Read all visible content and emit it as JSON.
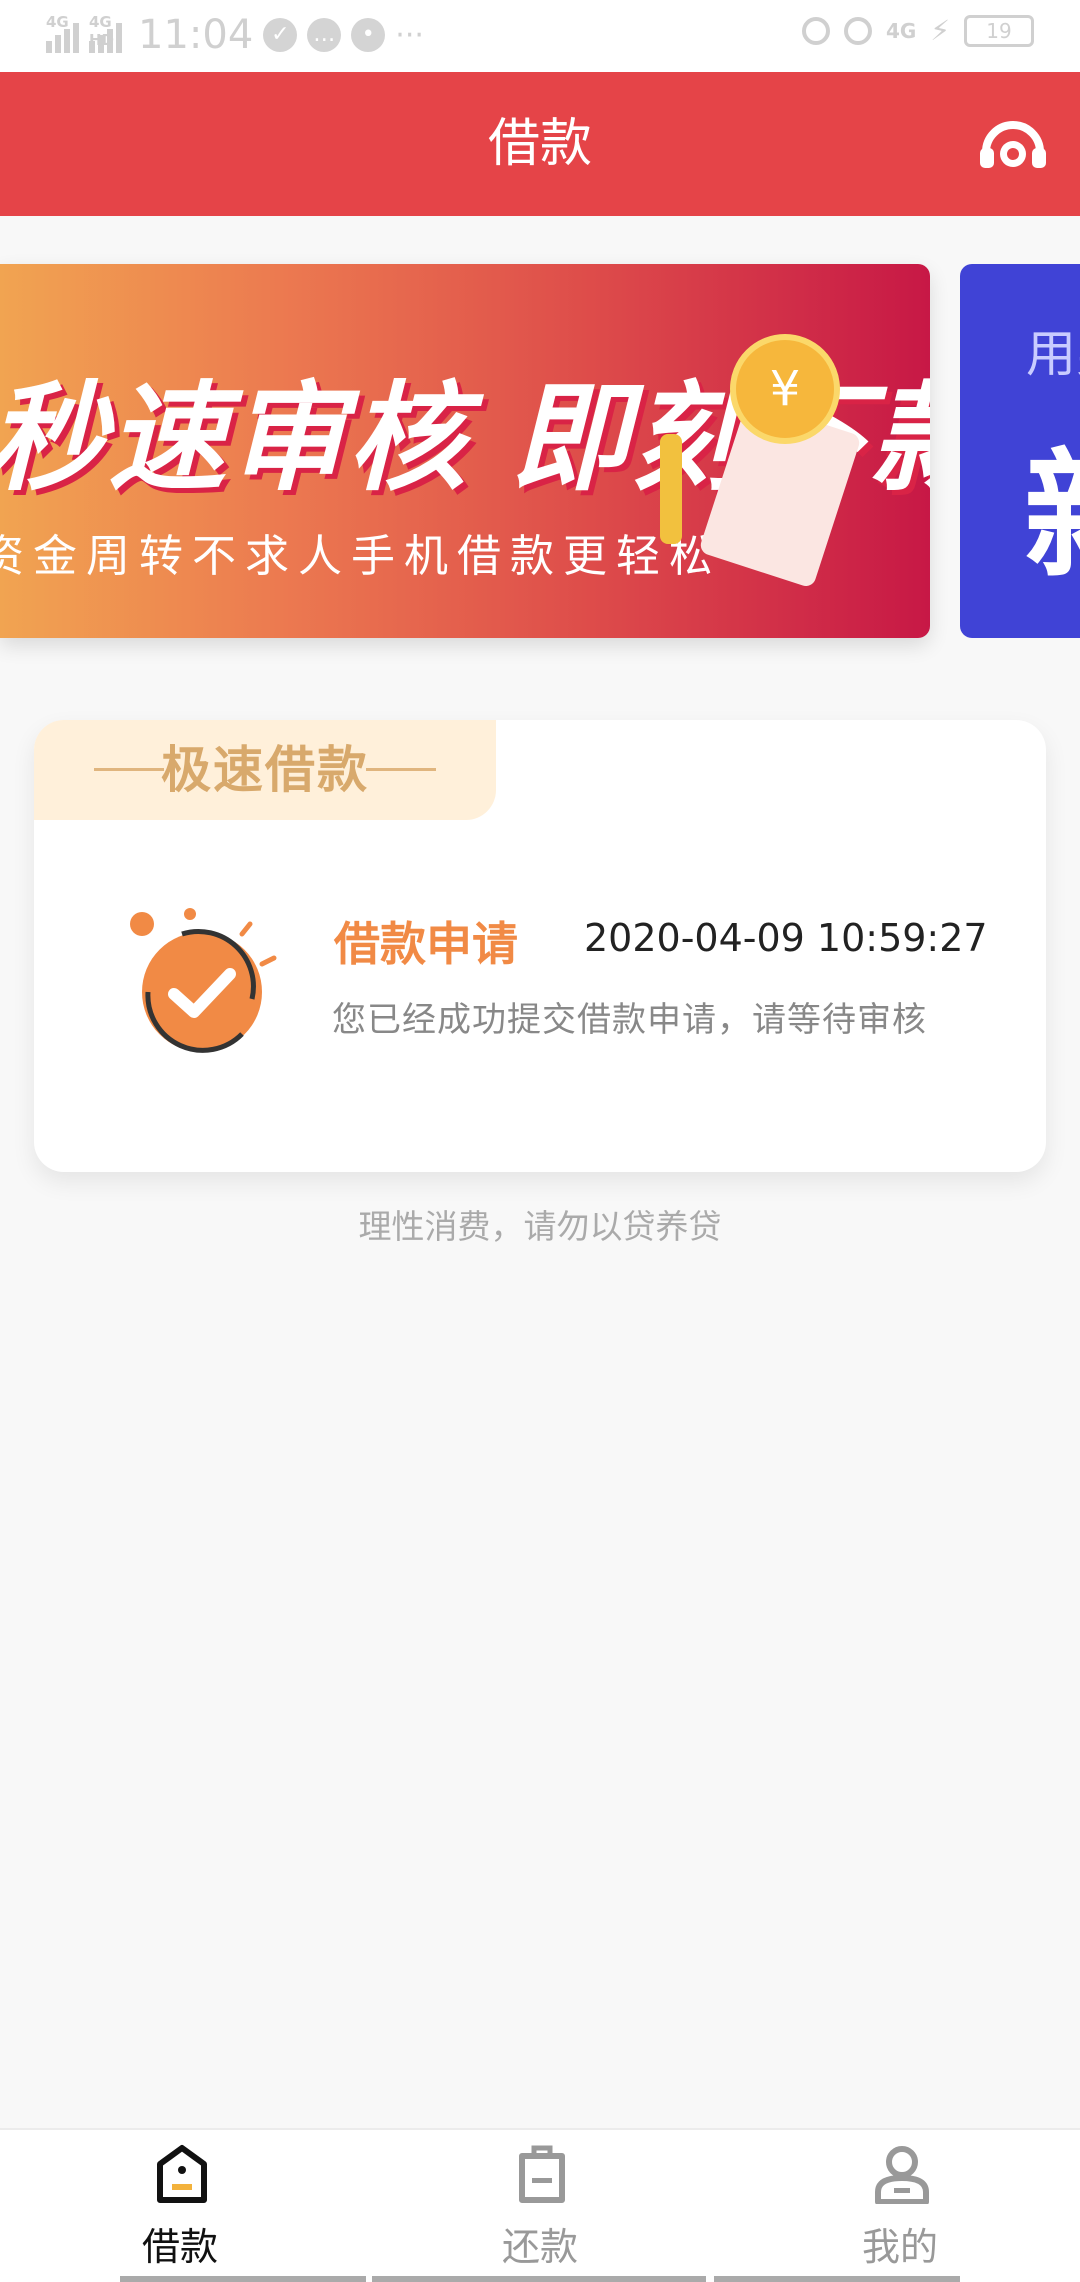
{
  "status_bar": {
    "time": "11:04",
    "network_1": "4G",
    "network_2": "4G HD",
    "network_right": "4G",
    "battery": "19"
  },
  "header": {
    "title": "借款",
    "icon": "headset-icon"
  },
  "banners": [
    {
      "headline": "秒速审核 即刻下款",
      "subline": "资金周转不求人手机借款更轻松"
    },
    {
      "headline_partial": "新",
      "subline_partial": "用身"
    }
  ],
  "loan_card": {
    "tab_label": "极速借款",
    "status_title": "借款申请",
    "status_time": "2020-04-09 10:59:27",
    "status_desc": "您已经成功提交借款申请，请等待审核"
  },
  "tip": "理性消费，请勿以贷养贷",
  "tabbar": {
    "items": [
      {
        "label": "借款",
        "icon": "borrow-icon",
        "active": true
      },
      {
        "label": "还款",
        "icon": "repay-icon",
        "active": false
      },
      {
        "label": "我的",
        "icon": "profile-icon",
        "active": false
      }
    ]
  },
  "colors": {
    "header_red": "#e54448",
    "accent_orange": "#f18a45",
    "tab_gold": "#d8a96c"
  }
}
